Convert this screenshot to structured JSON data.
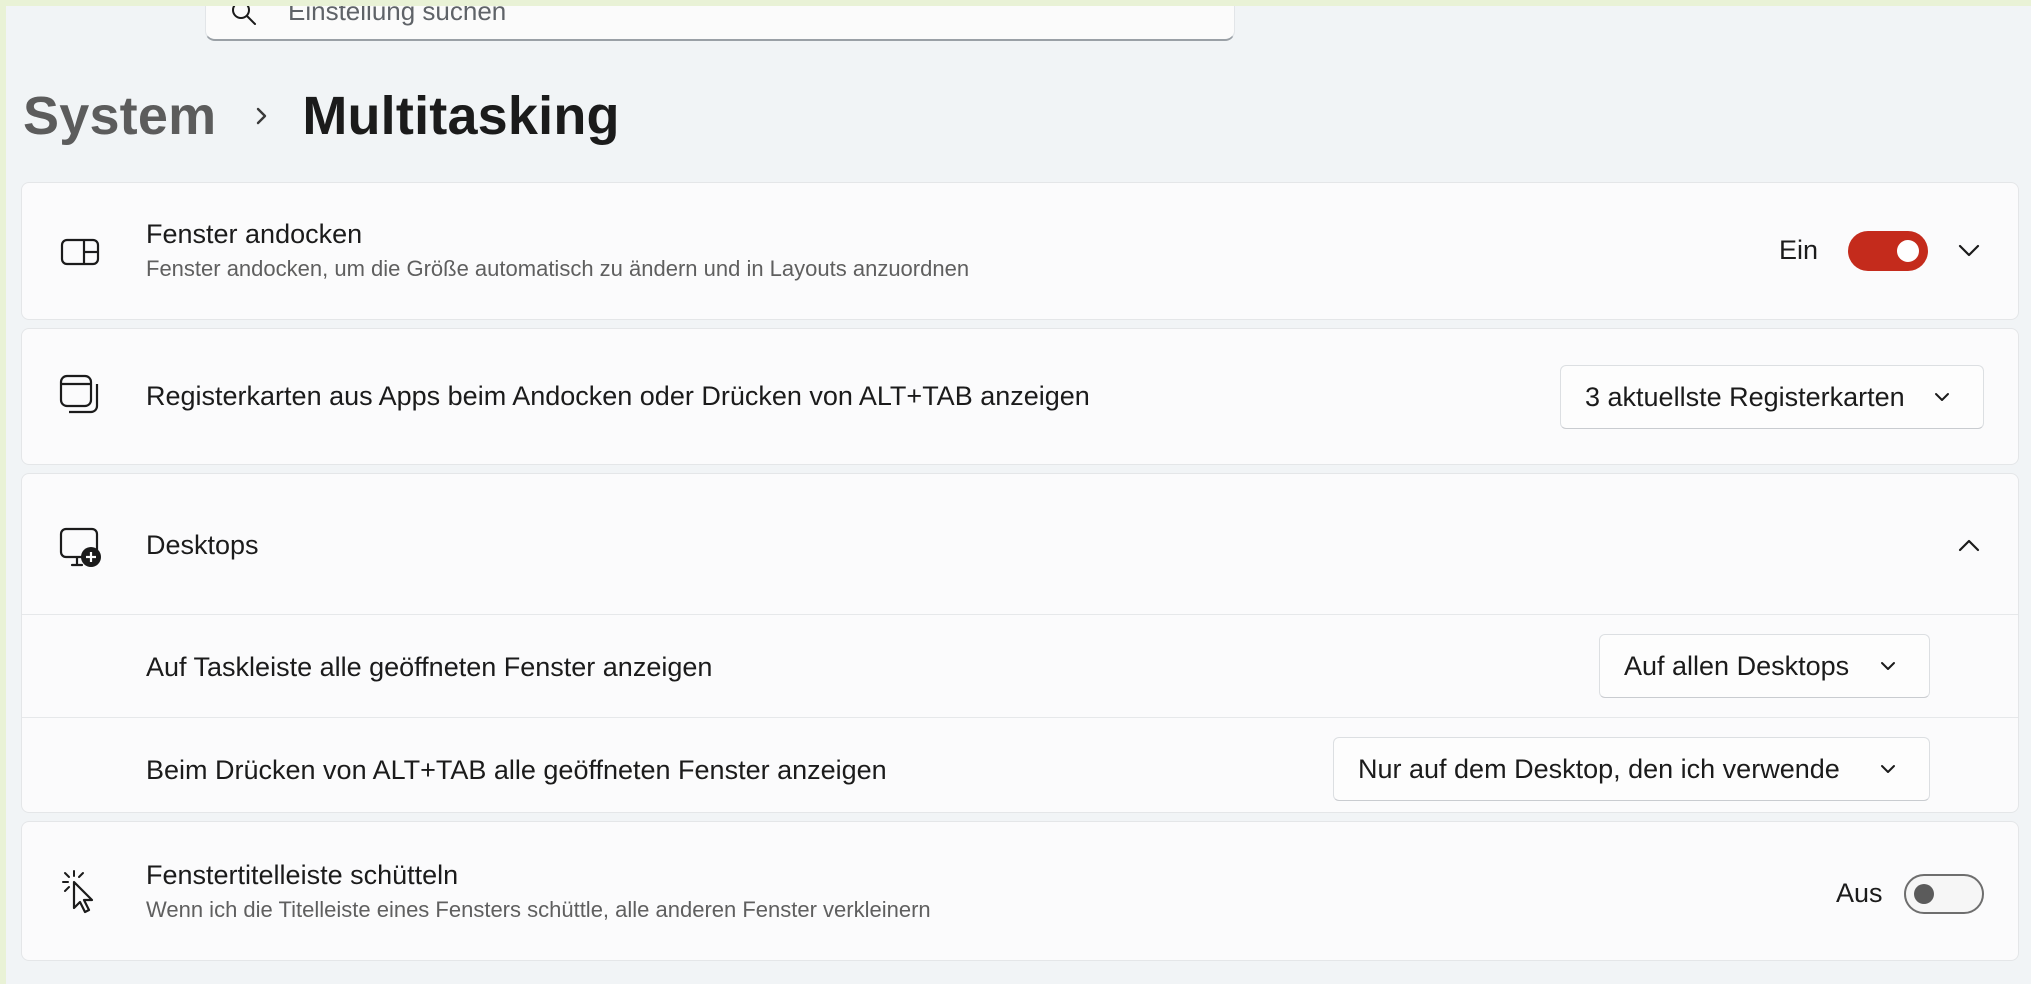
{
  "search": {
    "placeholder": "Einstellung suchen"
  },
  "breadcrumb": {
    "parent": "System",
    "current": "Multitasking"
  },
  "snap": {
    "title": "Fenster andocken",
    "description": "Fenster andocken, um die Größe automatisch zu ändern und in Layouts anzuordnen",
    "state_label": "Ein",
    "on": true
  },
  "tabs": {
    "title": "Registerkarten aus Apps beim Andocken oder Drücken von ALT+TAB anzeigen",
    "selected": "3 aktuellste Registerkarten"
  },
  "desktops": {
    "title": "Desktops",
    "expanded": true,
    "taskbar": {
      "title": "Auf Taskleiste alle geöffneten Fenster anzeigen",
      "selected": "Auf allen Desktops"
    },
    "alttab": {
      "title": "Beim Drücken von ALT+TAB alle geöffneten Fenster anzeigen",
      "selected": "Nur auf dem Desktop, den ich verwende"
    }
  },
  "shake": {
    "title": "Fenstertitelleiste schütteln",
    "description": "Wenn ich die Titelleiste eines Fensters schüttle, alle anderen Fenster verkleinern",
    "state_label": "Aus",
    "on": false
  },
  "colors": {
    "accent": "#c42b1c",
    "background": "#f1f4f6",
    "card": "#fbfbfc"
  }
}
